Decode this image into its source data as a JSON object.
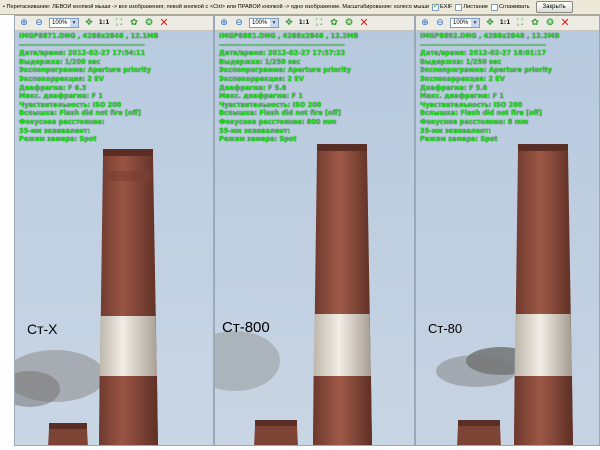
{
  "topbar": {
    "hint": "• Перетаскивание: ЛЕВОЙ кнопкой мыши -> все изображения; левой кнопкой с <Ctrl> или ПРАВОЙ кнопкой -> одно изображение. Масштабирование: колесо мыши",
    "options": [
      {
        "label": "EXIF",
        "checked": true
      },
      {
        "label": "Листание",
        "checked": false
      },
      {
        "label": "Сглаживать",
        "checked": false
      }
    ],
    "close_label": "Закрыть"
  },
  "toolbar": {
    "zoom_value": "100%",
    "icons": [
      "zoom-in-icon",
      "zoom-out-icon",
      "fit-icon",
      "actual-size-icon",
      "fullscreen-icon",
      "info-icon",
      "save-icon",
      "close-icon"
    ],
    "actual_size_label": "1:1"
  },
  "panes": [
    {
      "header": "IMGP8871.DNG , 4288x2848 , 12.1MB",
      "separator": "----------------------------------------------",
      "lines": [
        "Дата/время: 2012-02-27 17:54:11",
        "Выдержка: 1/200 sec",
        "Экспопрограмма: Aperture priority",
        "Экспокоррекция: 2 EV",
        "Диафрагма: F 6.3",
        "Макс. диафрагма: F 1",
        "Чувствительность: ISO 200",
        "Вспышка: Flash did not fire [off]",
        "Фокусное расстояние:",
        "35-мм эквивалент:",
        "Режим замера: Spot"
      ],
      "caption": "Ст-X"
    },
    {
      "header": "IMGP8881.DNG , 4288x2848 , 12.2MB",
      "separator": "----------------------------------------------",
      "lines": [
        "Дата/время: 2012-02-27 17:57:22",
        "Выдержка: 1/250 sec",
        "Экспопрограмма: Aperture priority",
        "Экспокоррекция: 2 EV",
        "Диафрагма: F 5.6",
        "Макс. диафрагма: F 1",
        "Чувствительность: ISO 200",
        "Вспышка: Flash did not fire [off]",
        "Фокусное расстояние: 800 mm",
        "35-мм эквивалент:",
        "Режим замера: Spot"
      ],
      "caption": "Ст-800"
    },
    {
      "header": "IMGP8892.DNG , 4288x2848 , 12.2MB",
      "separator": "----------------------------------------------",
      "lines": [
        "Дата/время: 2012-02-27 18:01:17",
        "Выдержка: 1/250 sec",
        "Экспопрограмма: Aperture priority",
        "Экспокоррекция: 2 EV",
        "Диафрагма: F 5.6",
        "Макс. диафрагма: F 1",
        "Чувствительность: ISO 200",
        "Вспышка: Flash did not fire [off]",
        "Фокусное расстояние: 8 mm",
        "35-мм эквивалент:",
        "Режим замера: Spot"
      ],
      "caption": "Ст-80"
    }
  ],
  "colors": {
    "exif_text": "#2cd62c",
    "sky": "#bfd0e2",
    "brick": "#8f4a3a",
    "white_band": "#ece6dc"
  }
}
